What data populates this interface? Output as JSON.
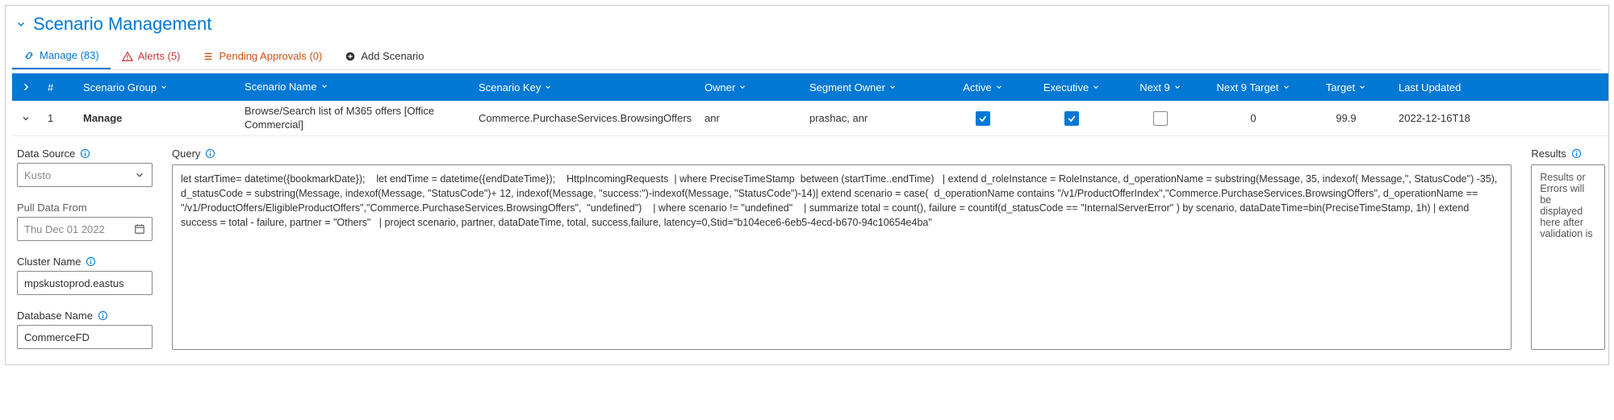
{
  "header": {
    "title": "Scenario Management"
  },
  "tabs": {
    "manage": {
      "label": "Manage (83)"
    },
    "alerts": {
      "label": "Alerts (5)"
    },
    "pending": {
      "label": "Pending Approvals (0)"
    },
    "add": {
      "label": "Add Scenario"
    }
  },
  "columns": {
    "num": "#",
    "group": "Scenario Group",
    "name": "Scenario Name",
    "key": "Scenario Key",
    "owner": "Owner",
    "segment": "Segment Owner",
    "active": "Active",
    "executive": "Executive",
    "next9": "Next 9",
    "next9target": "Next 9 Target",
    "target": "Target",
    "updated": "Last Updated"
  },
  "row": {
    "num": "1",
    "group": "Manage",
    "name": "Browse/Search list of M365 offers [Office Commercial]",
    "key": "Commerce.PurchaseServices.BrowsingOffers",
    "owner": "anr",
    "segment": "prashac, anr",
    "active": true,
    "executive": true,
    "next9": false,
    "next9target": "0",
    "target": "99.9",
    "updated": "2022-12-16T18"
  },
  "form": {
    "datasource_label": "Data Source",
    "datasource_value": "Kusto",
    "pulldata_label": "Pull Data From",
    "pulldata_value": "Thu Dec 01 2022",
    "cluster_label": "Cluster Name",
    "cluster_value": "mpskustoprod.eastus",
    "database_label": "Database Name",
    "database_value": "CommerceFD",
    "query_label": "Query",
    "query_value": "let startTime= datetime({bookmarkDate});    let endTime = datetime({endDateTime});    HttpIncomingRequests  | where PreciseTimeStamp  between (startTime..endTime)   | extend d_roleInstance = RoleInstance, d_operationName = substring(Message, 35, indexof( Message,\", StatusCode\") -35), d_statusCode = substring(Message, indexof(Message, \"StatusCode\")+ 12, indexof(Message, \"success:\")-indexof(Message, \"StatusCode\")-14)| extend scenario = case(  d_operationName contains \"/v1/ProductOfferIndex\",\"Commerce.PurchaseServices.BrowsingOffers\", d_operationName == \"/v1/ProductOffers/EligibleProductOffers\",\"Commerce.PurchaseServices.BrowsingOffers\",  \"undefined\")    | where scenario != \"undefined\"    | summarize total = count(), failure = countif(d_statusCode == \"InternalServerError\" ) by scenario, dataDateTime=bin(PreciseTimeStamp, 1h) | extend success = total - failure, partner = \"Others\"   | project scenario, partner, dataDateTime, total, success,failure, latency=0,Stid=\"b104ece6-6eb5-4ecd-b670-94c10654e4ba\"",
    "results_label": "Results",
    "results_placeholder": "Results or Errors will be displayed here after validation is"
  }
}
